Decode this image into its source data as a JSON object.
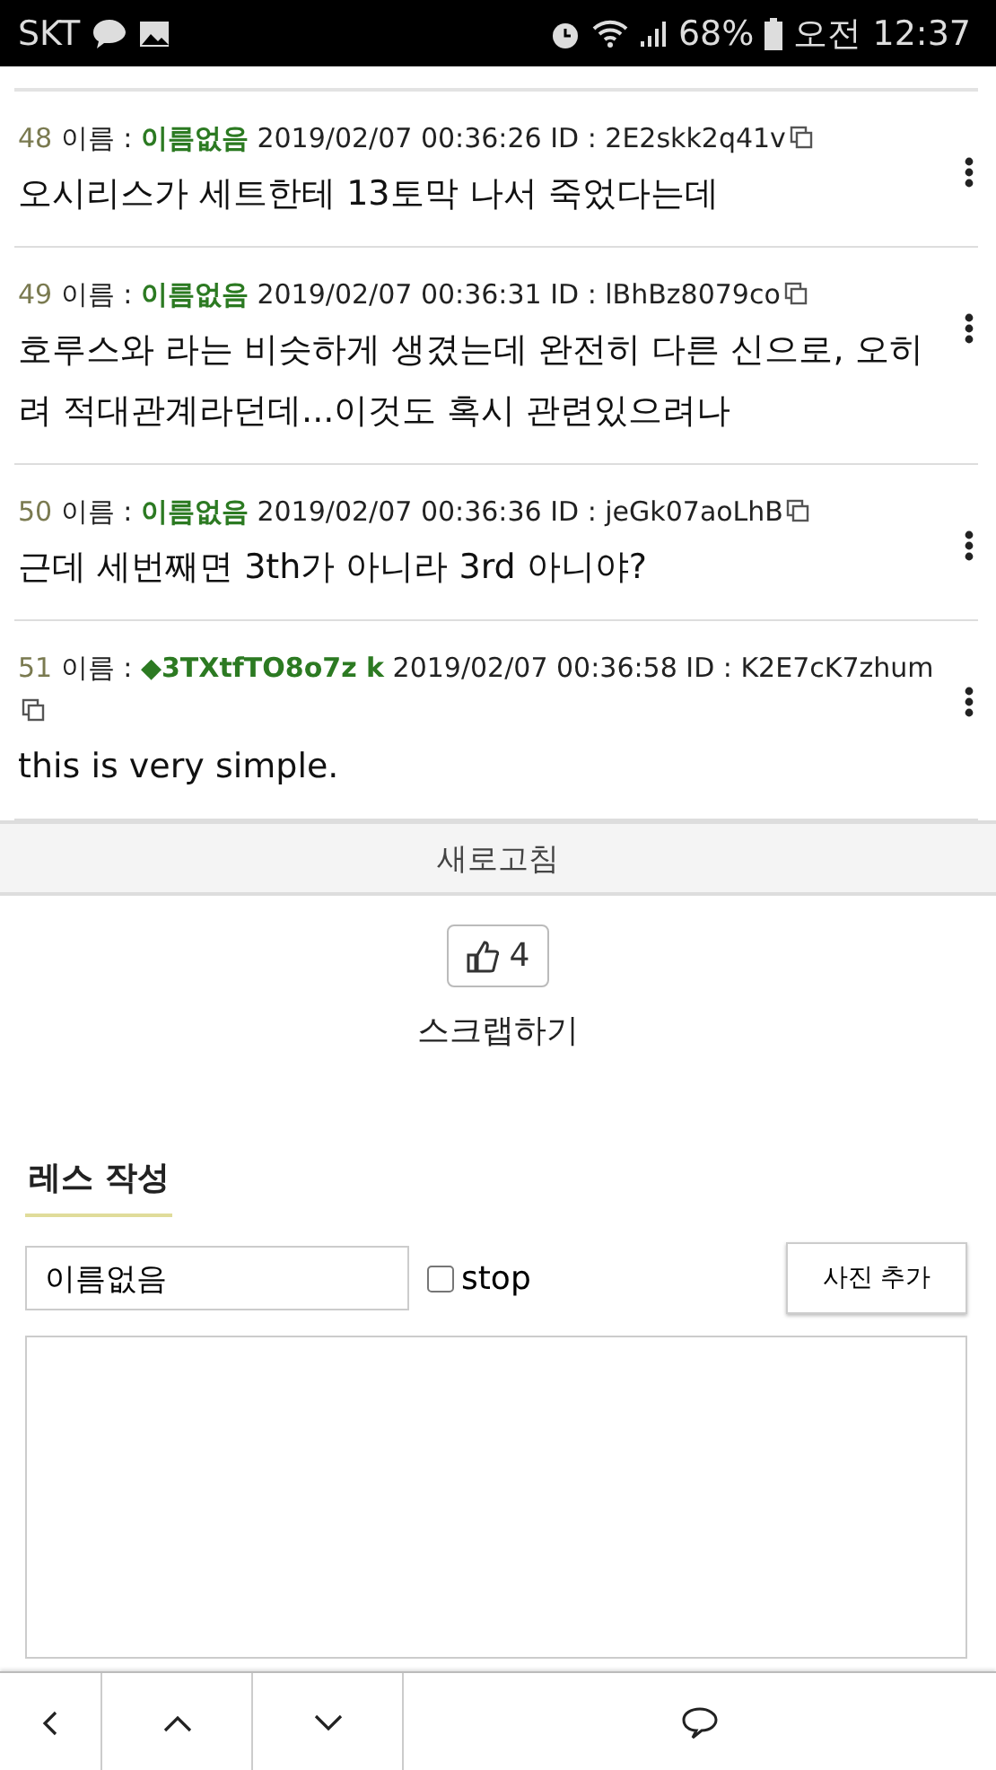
{
  "status_bar": {
    "carrier": "SKT",
    "battery": "68%",
    "time": "오전 12:37"
  },
  "posts": [
    {
      "number": "48",
      "name_label": "이름 :",
      "name": "이름없음",
      "datetime": "2019/02/07 00:36:26",
      "id_label": "ID :",
      "id": "2E2skk2q41v",
      "body": "오시리스가 세트한테 13토막 나서 죽었다는데"
    },
    {
      "number": "49",
      "name_label": "이름 :",
      "name": "이름없음",
      "datetime": "2019/02/07 00:36:31",
      "id_label": "ID :",
      "id": "lBhBz8079co",
      "body": "호루스와 라는 비슷하게 생겼는데 완전히 다른 신으로, 오히려 적대관계라던데...이것도 혹시 관련있으려나"
    },
    {
      "number": "50",
      "name_label": "이름 :",
      "name": "이름없음",
      "datetime": "2019/02/07 00:36:36",
      "id_label": "ID :",
      "id": "jeGk07aoLhB",
      "body": "근데 세번째면 3th가 아니라 3rd 아니야?"
    },
    {
      "number": "51",
      "name_label": "이름 :",
      "name": "◆3TXtfTO8o7z k",
      "datetime": "2019/02/07 00:36:58",
      "id_label": "ID :",
      "id": "K2E7cK7zhum",
      "body": "this is very simple."
    }
  ],
  "refresh_button": "새로고침",
  "like_count": "4",
  "scrap_link": "스크랩하기",
  "reply_form": {
    "title": "레스 작성",
    "name_value": "이름없음",
    "stop_label": "stop",
    "stop_checked": false,
    "photo_button": "사진 추가"
  }
}
